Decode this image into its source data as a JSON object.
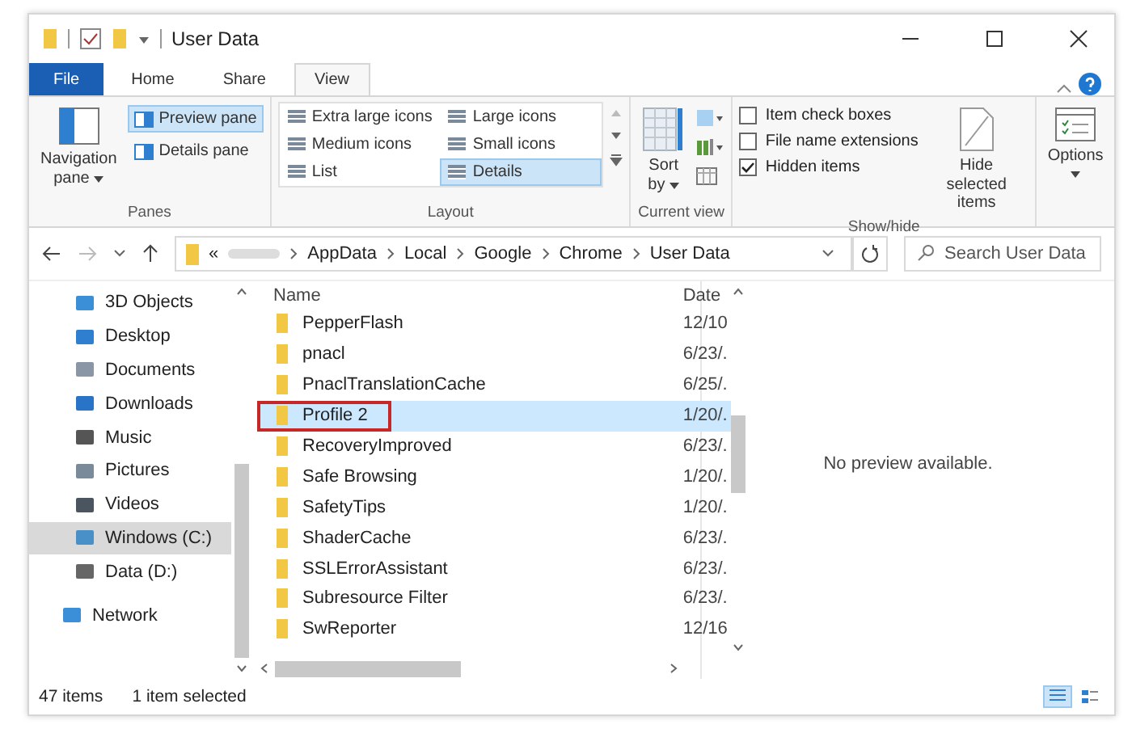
{
  "window": {
    "title": "User Data"
  },
  "tabs": [
    {
      "label": "File",
      "kind": "file",
      "selected": false
    },
    {
      "label": "Home",
      "kind": "tab",
      "selected": false
    },
    {
      "label": "Share",
      "kind": "tab",
      "selected": false
    },
    {
      "label": "View",
      "kind": "tab",
      "selected": true
    }
  ],
  "ribbon": {
    "panes": {
      "navigation_pane": [
        "Navigation",
        "pane"
      ],
      "preview_pane": {
        "label": "Preview pane",
        "selected": true
      },
      "details_pane": {
        "label": "Details pane",
        "selected": false
      },
      "label": "Panes"
    },
    "layout": {
      "items": [
        {
          "label": "Extra large icons",
          "selected": false
        },
        {
          "label": "Large icons",
          "selected": false
        },
        {
          "label": "Medium icons",
          "selected": false
        },
        {
          "label": "Small icons",
          "selected": false
        },
        {
          "label": "List",
          "selected": false
        },
        {
          "label": "Details",
          "selected": true
        }
      ],
      "label": "Layout"
    },
    "current_view": {
      "sort_by": [
        "Sort",
        "by"
      ],
      "label": "Current view"
    },
    "show_hide": {
      "checkboxes": [
        {
          "label": "Item check boxes",
          "checked": false
        },
        {
          "label": "File name extensions",
          "checked": false
        },
        {
          "label": "Hidden items",
          "checked": true
        }
      ],
      "hide_selected": "Hide selected items",
      "label": "Show/hide"
    },
    "options": "Options"
  },
  "address": {
    "prefix": "«",
    "crumbs": [
      "AppData",
      "Local",
      "Google",
      "Chrome",
      "User Data"
    ]
  },
  "search": {
    "placeholder": "Search User Data"
  },
  "sidebar": {
    "items": [
      {
        "label": "3D Objects",
        "selected": false
      },
      {
        "label": "Desktop",
        "selected": false
      },
      {
        "label": "Documents",
        "selected": false
      },
      {
        "label": "Downloads",
        "selected": false
      },
      {
        "label": "Music",
        "selected": false
      },
      {
        "label": "Pictures",
        "selected": false
      },
      {
        "label": "Videos",
        "selected": false
      },
      {
        "label": "Windows (C:)",
        "selected": true
      },
      {
        "label": "Data (D:)",
        "selected": false
      },
      {
        "label": "Network",
        "selected": false
      }
    ]
  },
  "table": {
    "columns": [
      "Name",
      "Date"
    ],
    "rows": [
      {
        "name": "PepperFlash",
        "date": "12/10",
        "selected": false,
        "outlined": false
      },
      {
        "name": "pnacl",
        "date": "6/23/.",
        "selected": false,
        "outlined": false
      },
      {
        "name": "PnaclTranslationCache",
        "date": "6/25/.",
        "selected": false,
        "outlined": false
      },
      {
        "name": "Profile 2",
        "date": "1/20/.",
        "selected": true,
        "outlined": true
      },
      {
        "name": "RecoveryImproved",
        "date": "6/23/.",
        "selected": false,
        "outlined": false
      },
      {
        "name": "Safe Browsing",
        "date": "1/20/.",
        "selected": false,
        "outlined": false
      },
      {
        "name": "SafetyTips",
        "date": "1/20/.",
        "selected": false,
        "outlined": false
      },
      {
        "name": "ShaderCache",
        "date": "6/23/.",
        "selected": false,
        "outlined": false
      },
      {
        "name": "SSLErrorAssistant",
        "date": "6/23/.",
        "selected": false,
        "outlined": false
      },
      {
        "name": "Subresource Filter",
        "date": "6/23/.",
        "selected": false,
        "outlined": false
      },
      {
        "name": "SwReporter",
        "date": "12/16",
        "selected": false,
        "outlined": false
      }
    ]
  },
  "preview": {
    "message": "No preview available."
  },
  "status_bar": {
    "items": [
      "47 items",
      "1 item selected"
    ],
    "views": [
      {
        "kind": "details",
        "selected": true
      },
      {
        "kind": "tiles",
        "selected": false
      }
    ]
  }
}
